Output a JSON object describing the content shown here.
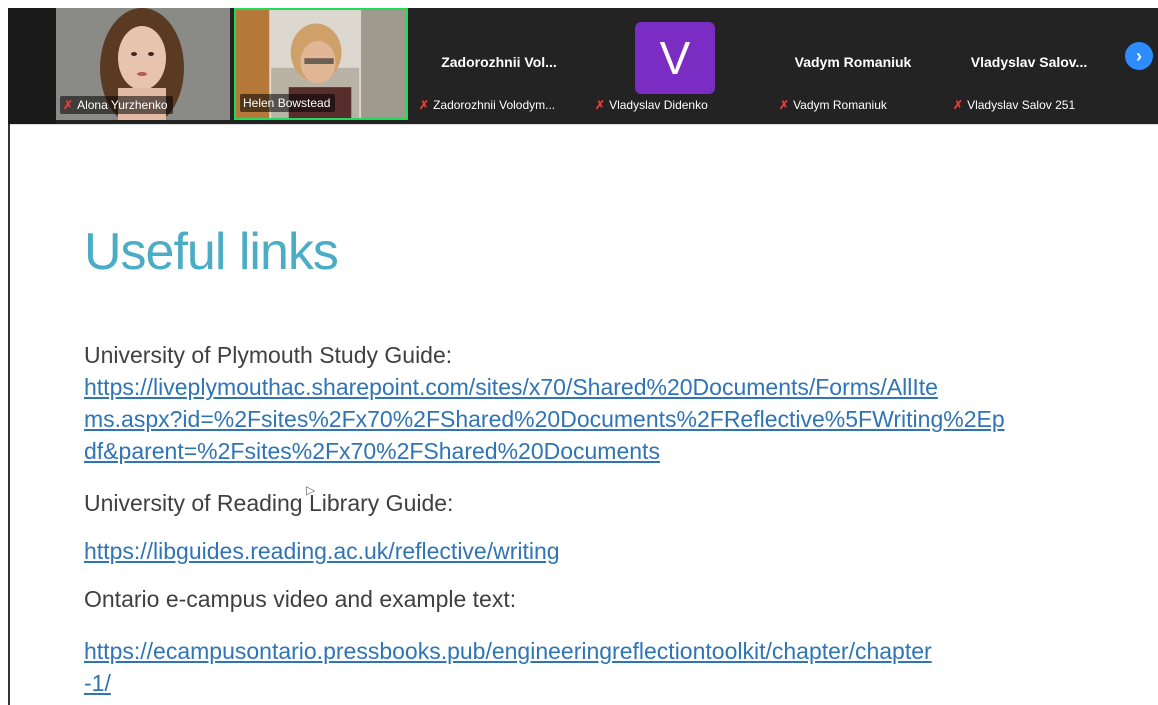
{
  "participants": [
    {
      "name": "Alona Yurzhenko",
      "muted": true,
      "type": "video"
    },
    {
      "name": "Helen Bowstead",
      "muted": false,
      "type": "video",
      "active": true
    },
    {
      "name": "Zadorozhnii Volodym...",
      "display_name": "Zadorozhnii Vol...",
      "muted": true,
      "type": "name"
    },
    {
      "name": "Vladyslav Didenko",
      "initial": "V",
      "muted": true,
      "type": "avatar"
    },
    {
      "name": "Vadym Romaniuk",
      "display_name": "Vadym Romaniuk",
      "muted": true,
      "type": "name"
    },
    {
      "name": "Vladyslav Salov 251",
      "display_name": "Vladyslav Salov...",
      "muted": true,
      "type": "name"
    }
  ],
  "colors": {
    "active_border": "#23d959",
    "avatar_bg": "#7b2cc3",
    "title": "#4bacc6",
    "link": "#2f74b5",
    "next_button": "#2d8cff"
  },
  "slide": {
    "title": "Useful links",
    "sections": [
      {
        "label": "University of Plymouth Study Guide:",
        "link_lines": [
          "https://liveplymouthac.sharepoint.com/sites/x70/Shared%20Documents/Forms/AllIte",
          "ms.aspx?id=%2Fsites%2Fx70%2FShared%20Documents%2FReflective%5FWriting%2Ep",
          "df&parent=%2Fsites%2Fx70%2FShared%20Documents"
        ]
      },
      {
        "label": "University of Reading Library Guide:",
        "link_lines": [
          "https://libguides.reading.ac.uk/reflective/writing"
        ]
      },
      {
        "label": "Ontario e-campus video and example text:",
        "link_lines": [
          "https://ecampusontario.pressbooks.pub/engineeringreflectiontoolkit/chapter/chapter",
          "-1/"
        ]
      }
    ]
  }
}
